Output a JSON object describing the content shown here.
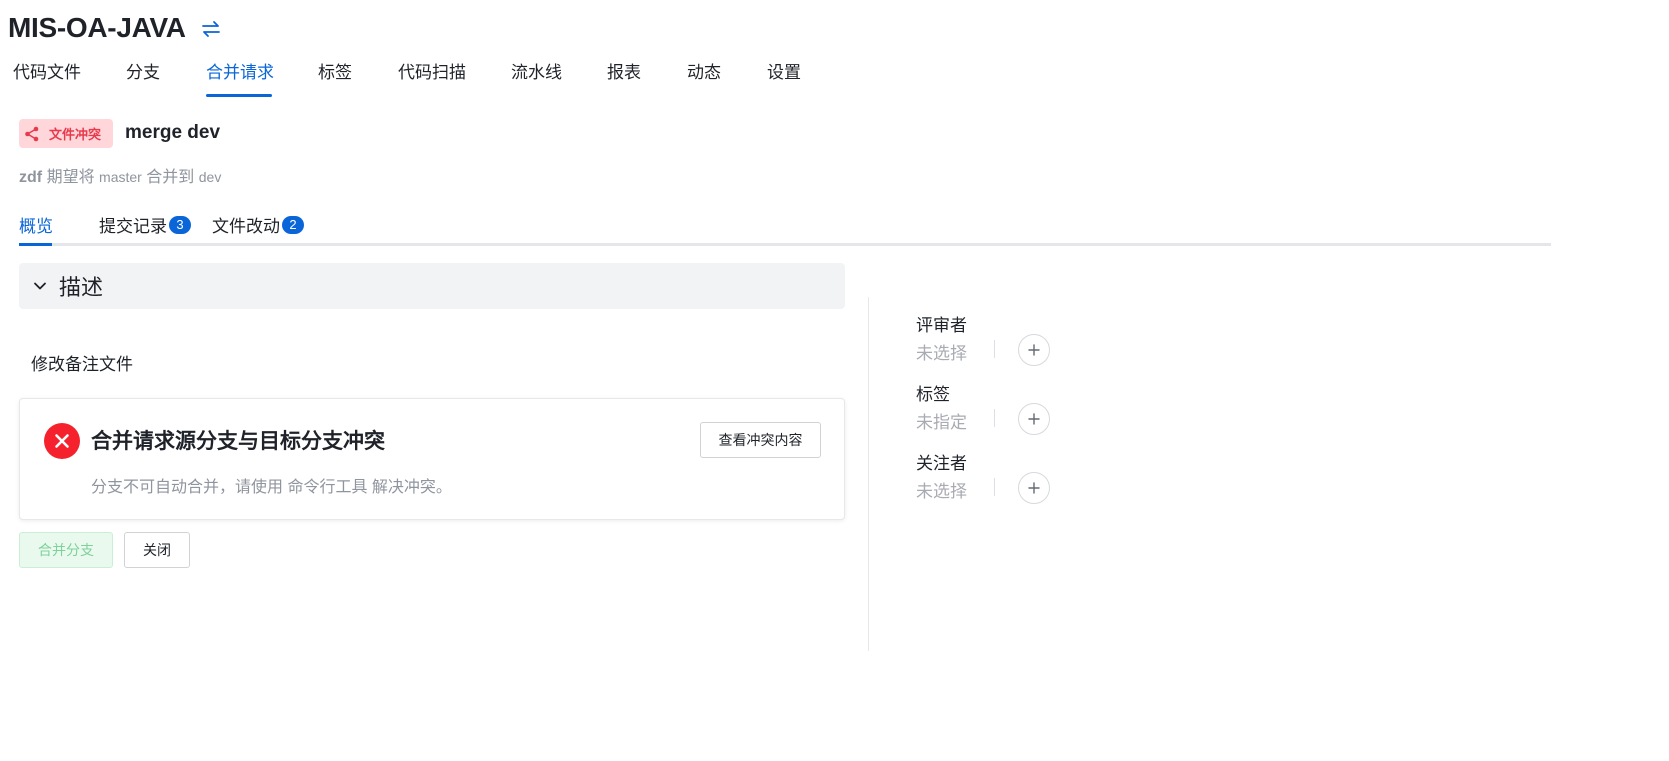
{
  "repo": {
    "title": "MIS-OA-JAVA",
    "switch_icon": "swap-icon"
  },
  "nav": {
    "items": [
      "代码文件",
      "分支",
      "合并请求",
      "标签",
      "代码扫描",
      "流水线",
      "报表",
      "动态",
      "设置"
    ],
    "active": "合并请求"
  },
  "mr": {
    "badge": "文件冲突",
    "badge_icon": "share-icon",
    "title": "merge dev",
    "author": "zdf",
    "expect": "期望将",
    "source_branch": "master",
    "merge_to": "合并到",
    "target_branch": "dev"
  },
  "tabs": {
    "overview": "概览",
    "commits": "提交记录",
    "commits_count": "3",
    "changes": "文件改动",
    "changes_count": "2"
  },
  "description": {
    "header": "描述",
    "text": "修改备注文件"
  },
  "conflict": {
    "heading": "合并请求源分支与目标分支冲突",
    "text": "分支不可自动合并，请使用 命令行工具 解决冲突。",
    "view_button": "查看冲突内容"
  },
  "actions": {
    "merge": "合并分支",
    "close": "关闭"
  },
  "sidebar": {
    "reviewers_label": "评审者",
    "reviewers_value": "未选择",
    "labels_label": "标签",
    "labels_value": "未指定",
    "watchers_label": "关注者",
    "watchers_value": "未选择"
  },
  "colors": {
    "accent": "#0a66d8",
    "conflict_badge_bg": "#ffd6da",
    "conflict_badge_text": "#e83a4c",
    "error": "#f5222d",
    "merge_disabled_bg": "#e9f9ee"
  }
}
